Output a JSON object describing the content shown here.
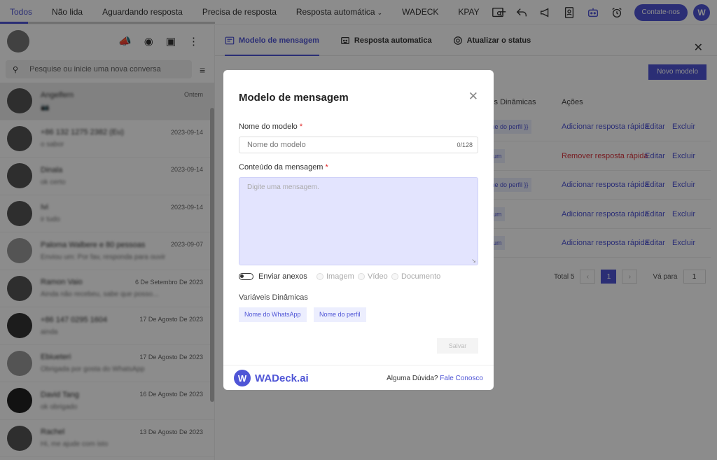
{
  "top_tabs": [
    {
      "label": "Todos"
    },
    {
      "label": "Não lida"
    },
    {
      "label": "Aguardando resposta"
    },
    {
      "label": "Precisa de resposta"
    },
    {
      "label": "Resposta automática"
    },
    {
      "label": "WADECK"
    },
    {
      "label": "KPAY"
    }
  ],
  "top_add": "+",
  "contact_button": "Contate-nos",
  "user_logo": "W",
  "search": {
    "placeholder": "Pesquise ou inicie uma nova conversa"
  },
  "chats": [
    {
      "name": "Angelfern",
      "preview": "📷",
      "date": "Ontem"
    },
    {
      "name": "+86 132 1275 2382 (Eu)",
      "preview": "o sabor",
      "date": "2023-09-14"
    },
    {
      "name": "Dinala",
      "preview": "ok certo",
      "date": "2023-09-14"
    },
    {
      "name": "Ivi",
      "preview": "ir tudo",
      "date": "2023-09-14"
    },
    {
      "name": "Paloma Walbere e 80 pessoas",
      "preview": "Enviou um: Por fav, responda para ouvir",
      "date": "2023-09-07"
    },
    {
      "name": "Ramon Vaio",
      "preview": "Ainda não recebeu, sabe que posso...",
      "date": "6 De Setembro De 2023"
    },
    {
      "name": "+86 147 0295 1604",
      "preview": "ainda",
      "date": "17 De Agosto De 2023"
    },
    {
      "name": "Ebiueteri",
      "preview": "Obrigada por gosta do WhatsApp",
      "date": "17 De Agosto De 2023"
    },
    {
      "name": "David Tang",
      "preview": "ok obrigado",
      "date": "16 De Agosto De 2023"
    },
    {
      "name": "Rachel",
      "preview": "Hi, me ajude com isto",
      "date": "13 De Agosto De 2023"
    }
  ],
  "right_tabs": [
    {
      "label": "Modelo de mensagem",
      "icon": "message-template-icon"
    },
    {
      "label": "Resposta automatica",
      "icon": "robot-icon"
    },
    {
      "label": "Atualizar o status",
      "icon": "status-icon"
    }
  ],
  "new_model_button": "Novo modelo",
  "table_headers": {
    "vars": "eis Dinâmicas",
    "actions": "Ações"
  },
  "rows": [
    {
      "chip": "me do perfil }}",
      "action": "Adicionar resposta rápida",
      "edit": "Editar",
      "delete": "Excluir"
    },
    {
      "chip": "num",
      "action": "Remover resposta rápida",
      "edit": "Editar",
      "delete": "Excluir"
    },
    {
      "chip": "me do perfil }}",
      "action": "Adicionar resposta rápida",
      "edit": "Editar",
      "delete": "Excluir"
    },
    {
      "chip": "num",
      "action": "Adicionar resposta rápida",
      "edit": "Editar",
      "delete": "Excluir"
    },
    {
      "chip": "num",
      "action": "Adicionar resposta rápida",
      "edit": "Editar",
      "delete": "Excluir"
    }
  ],
  "pagination": {
    "total": "Total 5",
    "current_page": "1",
    "goto_label": "Vá para",
    "goto_value": "1"
  },
  "modal": {
    "title": "Modelo de mensagem",
    "name_label": "Nome do modelo",
    "name_placeholder": "Nome do modelo",
    "name_counter": "0/128",
    "content_label": "Conteúdo da mensagem",
    "content_placeholder": "Digite uma mensagem.",
    "attach_label": "Enviar anexos",
    "attach_options": [
      "Imagem",
      "Vídeo",
      "Documento"
    ],
    "vars_title": "Variáveis Dinâmicas",
    "var_chips": [
      "Nome do WhatsApp",
      "Nome do perfil"
    ],
    "save_button": "Salvar",
    "required_mark": "*",
    "brand_name": "WADeck.ai",
    "brand_logo": "W",
    "help_text": "Alguma Dúvida?",
    "help_link": "Fale Conosco"
  },
  "colors": {
    "accent": "#4f55d6",
    "danger": "#d9363e",
    "textarea_bg": "#e3e4fe"
  }
}
